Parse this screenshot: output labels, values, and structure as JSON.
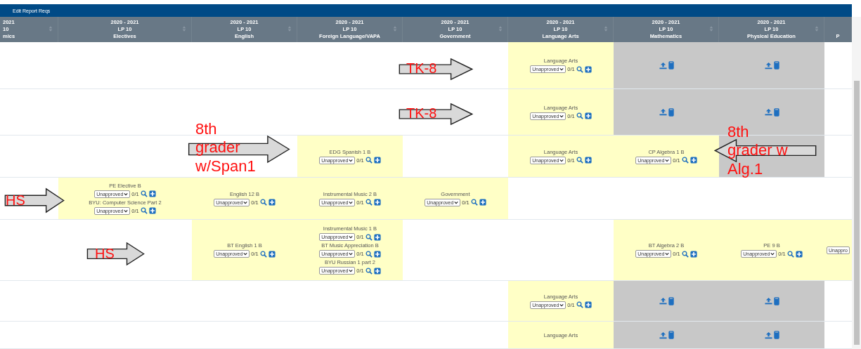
{
  "toolbar": {
    "button": "Edit Report Reqs"
  },
  "columns": [
    {
      "year": "2021",
      "term": "10",
      "subject": "mics",
      "sortable": true
    },
    {
      "year": "2020 - 2021",
      "term": "LP 10",
      "subject": "Electives",
      "sortable": true
    },
    {
      "year": "2020 - 2021",
      "term": "LP 10",
      "subject": "English",
      "sortable": true
    },
    {
      "year": "2020 - 2021",
      "term": "LP 10",
      "subject": "Foreign Language/VAPA",
      "sortable": true
    },
    {
      "year": "2020 - 2021",
      "term": "LP 10",
      "subject": "Government",
      "sortable": true
    },
    {
      "year": "2020 - 2021",
      "term": "LP 10",
      "subject": "Language Arts",
      "sortable": true
    },
    {
      "year": "2020 - 2021",
      "term": "LP 10",
      "subject": "Mathematics",
      "sortable": true
    },
    {
      "year": "2020 - 2021",
      "term": "LP 10",
      "subject": "Physical Education",
      "sortable": true
    },
    {
      "subject": "P",
      "sortable": false
    }
  ],
  "rows": [
    {
      "cells": [
        {
          "kind": "empty"
        },
        {
          "kind": "empty"
        },
        {
          "kind": "empty"
        },
        {
          "kind": "empty"
        },
        {
          "kind": "empty"
        },
        {
          "kind": "req",
          "entries": [
            {
              "title": "Language Arts",
              "status": "Unapproved",
              "count": "0/1"
            }
          ]
        },
        {
          "kind": "upload"
        },
        {
          "kind": "upload"
        },
        {
          "kind": "empty"
        }
      ]
    },
    {
      "cells": [
        {
          "kind": "empty"
        },
        {
          "kind": "empty"
        },
        {
          "kind": "empty"
        },
        {
          "kind": "empty"
        },
        {
          "kind": "empty"
        },
        {
          "kind": "req",
          "entries": [
            {
              "title": "Language Arts",
              "status": "Unapproved",
              "count": "0/1"
            }
          ]
        },
        {
          "kind": "upload"
        },
        {
          "kind": "upload"
        },
        {
          "kind": "empty"
        }
      ]
    },
    {
      "cells": [
        {
          "kind": "empty"
        },
        {
          "kind": "empty"
        },
        {
          "kind": "empty"
        },
        {
          "kind": "req",
          "entries": [
            {
              "title": "EDG Spanish 1 B",
              "status": "Unapproved",
              "count": "0/1"
            }
          ]
        },
        {
          "kind": "empty"
        },
        {
          "kind": "req",
          "entries": [
            {
              "title": "Language Arts",
              "status": "Unapproved",
              "count": "0/1"
            }
          ]
        },
        {
          "kind": "req",
          "entries": [
            {
              "title": "CP Algebra 1 B",
              "status": "Unapproved",
              "count": "0/1"
            }
          ]
        },
        {
          "kind": "covered"
        },
        {
          "kind": "empty"
        }
      ]
    },
    {
      "cells": [
        {
          "kind": "empty"
        },
        {
          "kind": "req",
          "entries": [
            {
              "title": "PE Elective B",
              "status": "Unapproved",
              "count": "0/1"
            },
            {
              "title": "BYU: Computer Science Part 2",
              "status": "Unapproved",
              "count": "0/1"
            }
          ]
        },
        {
          "kind": "req",
          "entries": [
            {
              "title": "English 12 B",
              "status": "Unapproved",
              "count": "0/1"
            }
          ]
        },
        {
          "kind": "req",
          "entries": [
            {
              "title": "Instrumental Music 2 B",
              "status": "Unapproved",
              "count": "0/1"
            }
          ]
        },
        {
          "kind": "req",
          "entries": [
            {
              "title": "Government",
              "status": "Unapproved",
              "count": "0/1"
            }
          ]
        },
        {
          "kind": "empty"
        },
        {
          "kind": "empty"
        },
        {
          "kind": "empty"
        },
        {
          "kind": "empty"
        }
      ]
    },
    {
      "cells": [
        {
          "kind": "empty"
        },
        {
          "kind": "empty"
        },
        {
          "kind": "req",
          "entries": [
            {
              "title": "BT English 1 B",
              "status": "Unapproved",
              "count": "0/1"
            }
          ]
        },
        {
          "kind": "req",
          "entries": [
            {
              "title": "Instrumental Music 1 B",
              "status": "Unapproved",
              "count": "0/1"
            },
            {
              "title": "BT Music Appreciation B",
              "status": "Unapproved",
              "count": "0/1"
            },
            {
              "title": "BYU Russian 1 part 2",
              "status": "Unapproved",
              "count": "0/1"
            }
          ]
        },
        {
          "kind": "empty"
        },
        {
          "kind": "empty"
        },
        {
          "kind": "req",
          "entries": [
            {
              "title": "BT Algebra 2 B",
              "status": "Unapproved",
              "count": "0/1"
            }
          ]
        },
        {
          "kind": "req",
          "entries": [
            {
              "title": "PE 9 B",
              "status": "Unapproved",
              "count": "0/1"
            }
          ]
        },
        {
          "kind": "req",
          "entries": [
            {
              "status": "Unappro"
            }
          ]
        }
      ]
    },
    {
      "cells": [
        {
          "kind": "empty"
        },
        {
          "kind": "empty"
        },
        {
          "kind": "empty"
        },
        {
          "kind": "empty"
        },
        {
          "kind": "empty"
        },
        {
          "kind": "req",
          "entries": [
            {
              "title": "Language Arts",
              "status": "Unapproved",
              "count": "0/1"
            }
          ]
        },
        {
          "kind": "upload"
        },
        {
          "kind": "upload"
        },
        {
          "kind": "empty"
        }
      ]
    },
    {
      "cells": [
        {
          "kind": "empty"
        },
        {
          "kind": "empty"
        },
        {
          "kind": "empty"
        },
        {
          "kind": "empty"
        },
        {
          "kind": "empty"
        },
        {
          "kind": "req",
          "entries": [
            {
              "title": "Language Arts"
            }
          ]
        },
        {
          "kind": "upload"
        },
        {
          "kind": "upload"
        },
        {
          "kind": "empty"
        }
      ]
    }
  ],
  "annotations": [
    {
      "text": "TK-8",
      "kind": "right"
    },
    {
      "text": "TK-8",
      "kind": "right"
    },
    {
      "text": "8th grader w/Span1",
      "kind": "right"
    },
    {
      "text": "8th grader w Alg.1",
      "kind": "left"
    },
    {
      "text": "HS",
      "kind": "right"
    },
    {
      "text": "HS",
      "kind": "right"
    }
  ]
}
